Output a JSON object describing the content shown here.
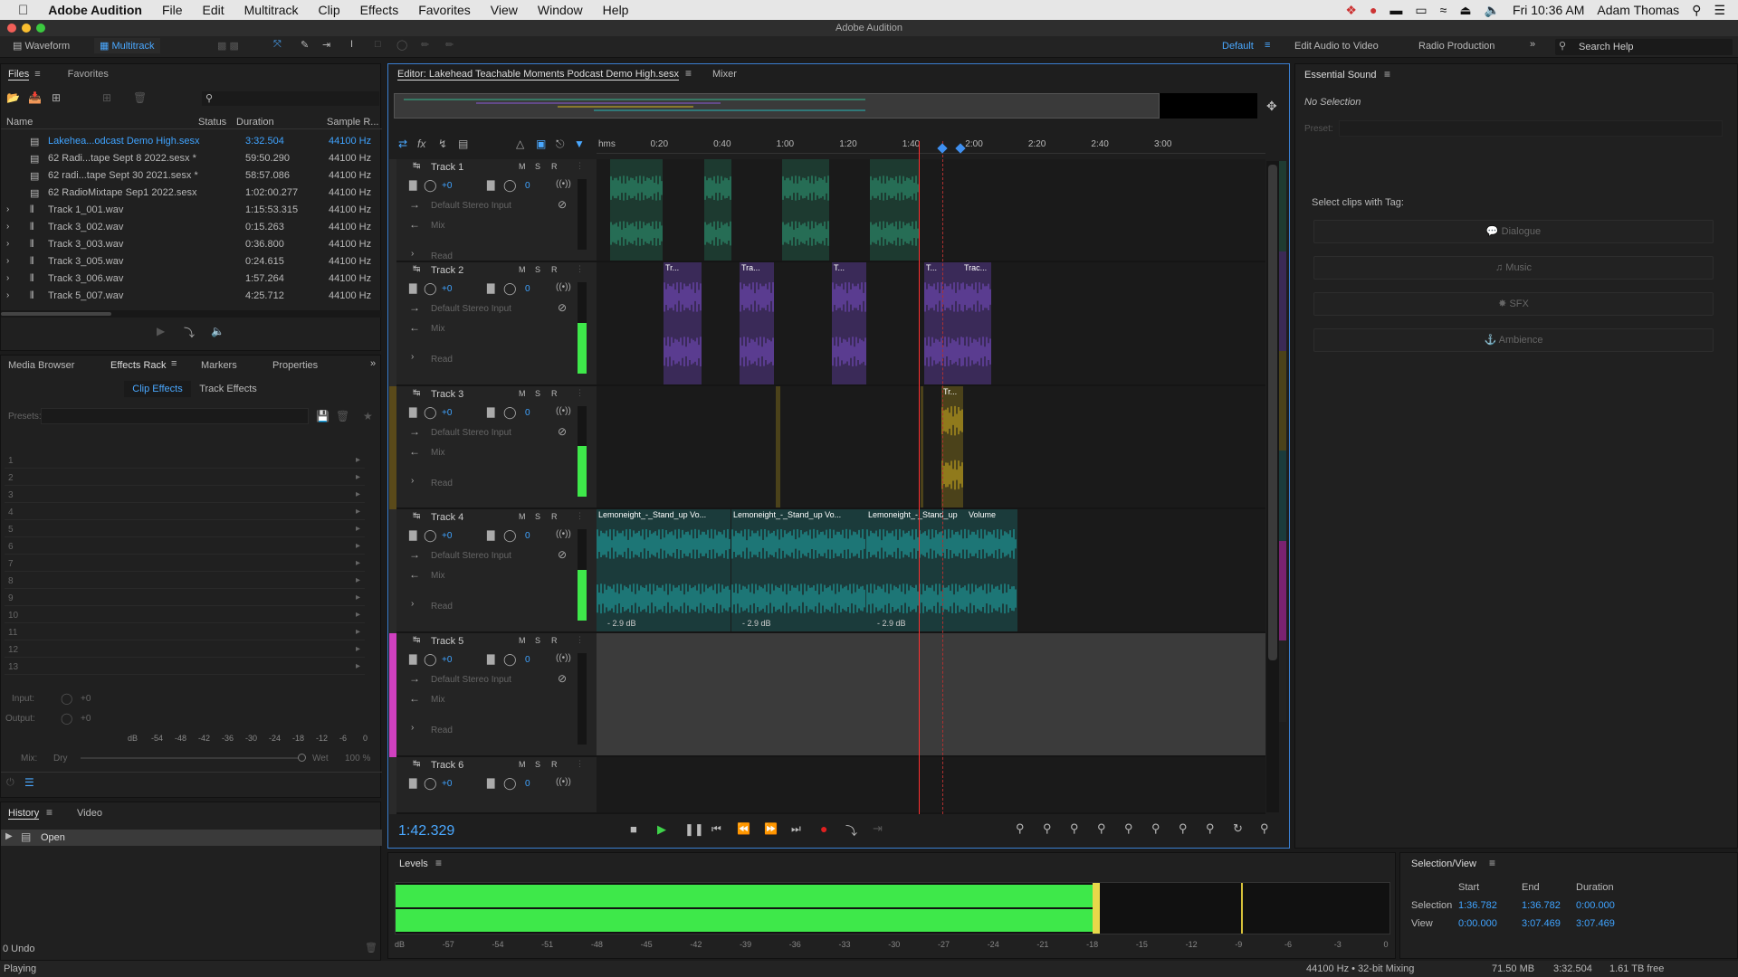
{
  "menubar": {
    "app_name": "Adobe Audition",
    "items": [
      "File",
      "Edit",
      "Multitrack",
      "Clip",
      "Effects",
      "Favorites",
      "View",
      "Window",
      "Help"
    ],
    "clock": "Fri 10:36 AM",
    "user": "Adam Thomas"
  },
  "window_title": "Adobe Audition",
  "toolbar": {
    "waveform_label": "Waveform",
    "multitrack_label": "Multitrack",
    "workspace_default": "Default",
    "workspace_edit_video": "Edit Audio to Video",
    "workspace_radio": "Radio Production",
    "search_placeholder": "Search Help"
  },
  "files_panel": {
    "tab_files": "Files",
    "tab_favorites": "Favorites",
    "columns": [
      "Name",
      "Status",
      "Duration",
      "Sample R..."
    ],
    "rows": [
      {
        "name": "Lakehea...odcast Demo High.sesx",
        "duration": "3:32.504",
        "rate": "44100 Hz",
        "active": true
      },
      {
        "name": "62 Radi...tape Sept 8 2022.sesx *",
        "duration": "59:50.290",
        "rate": "44100 Hz"
      },
      {
        "name": "62 radi...tape Sept 30 2021.sesx *",
        "duration": "58:57.086",
        "rate": "44100 Hz"
      },
      {
        "name": "62 RadioMixtape Sep1 2022.sesx",
        "duration": "1:02:00.277",
        "rate": "44100 Hz"
      },
      {
        "name": "Track 1_001.wav",
        "duration": "1:15:53.315",
        "rate": "44100 Hz"
      },
      {
        "name": "Track 3_002.wav",
        "duration": "0:15.263",
        "rate": "44100 Hz"
      },
      {
        "name": "Track 3_003.wav",
        "duration": "0:36.800",
        "rate": "44100 Hz"
      },
      {
        "name": "Track 3_005.wav",
        "duration": "0:24.615",
        "rate": "44100 Hz"
      },
      {
        "name": "Track 3_006.wav",
        "duration": "1:57.264",
        "rate": "44100 Hz"
      },
      {
        "name": "Track 5_007.wav",
        "duration": "4:25.712",
        "rate": "44100 Hz"
      }
    ]
  },
  "effects_panel": {
    "tabs": [
      "Media Browser",
      "Effects Rack",
      "Markers",
      "Properties"
    ],
    "subtabs": [
      "Clip Effects",
      "Track Effects"
    ],
    "presets_label": "Presets:",
    "slots": [
      "1",
      "2",
      "3",
      "4",
      "5",
      "6",
      "7",
      "8",
      "9",
      "10",
      "11",
      "12",
      "13"
    ],
    "input_label": "Input:",
    "output_label": "Output:",
    "gain_value": "+0",
    "db_scale": [
      "dB",
      "-54",
      "-48",
      "-42",
      "-36",
      "-30",
      "-24",
      "-18",
      "-12",
      "-6",
      "0"
    ],
    "mix_label": "Mix:",
    "dry_label": "Dry",
    "wet_label": "Wet",
    "mix_value": "100 %"
  },
  "history_panel": {
    "tabs": [
      "History",
      "Video"
    ],
    "items": [
      "Open"
    ],
    "undo_count": "0 Undo"
  },
  "status_bar": {
    "state": "Playing",
    "sample_info": "44100 Hz • 32-bit Mixing",
    "memory": "71.50 MB",
    "duration": "3:32.504",
    "disk_free": "1.61 TB free"
  },
  "editor": {
    "title": "Editor: Lakehead Teachable Moments Podcast Demo High.sesx",
    "mixer_tab": "Mixer",
    "time_ruler": [
      "hms",
      "0:20",
      "0:40",
      "1:00",
      "1:20",
      "1:40",
      "2:00",
      "2:20",
      "2:40",
      "3:00"
    ],
    "current_time": "1:42.329",
    "playhead_seconds": 102.329,
    "timeline_total_seconds": 212.504,
    "tracks": [
      {
        "name": "Track 1",
        "color": "#2fa07a",
        "input": "Default Stereo Input",
        "output": "Mix",
        "mode": "Read",
        "volume": "+0",
        "pan": "0"
      },
      {
        "name": "Track 2",
        "color": "#7b4dc9",
        "input": "Default Stereo Input",
        "output": "Mix",
        "mode": "Read",
        "volume": "+0",
        "pan": "0"
      },
      {
        "name": "Track 3",
        "color": "#d4b21e",
        "input": "Default Stereo Input",
        "output": "Mix",
        "mode": "Read",
        "volume": "+0",
        "pan": "0"
      },
      {
        "name": "Track 4",
        "color": "#1fb0b0",
        "input": "Default Stereo Input",
        "output": "Mix",
        "mode": "Read",
        "volume": "+0",
        "pan": "0"
      },
      {
        "name": "Track 5",
        "color": "#e040d0",
        "input": "Default Stereo Input",
        "output": "Mix",
        "mode": "Read",
        "volume": "+0",
        "pan": "0"
      },
      {
        "name": "Track 6",
        "color": "#3a3a3a",
        "volume": "+0",
        "pan": "0"
      }
    ],
    "track2_clips": [
      "Tr...",
      "Tra...",
      "T...",
      "T...",
      "Trac..."
    ],
    "track3_clips": [
      "Tr..."
    ],
    "track4_clips": [
      "Lemoneight_-_Stand_up Vo...",
      "Lemoneight_-_Stand_up Vo...",
      "Lemoneight_-_Stand_up"
    ],
    "track4_volume_label": "Volume",
    "track4_clip_gain": "- 2.9 dB",
    "msr": [
      "M",
      "S",
      "R"
    ]
  },
  "essential_sound": {
    "title": "Essential Sound",
    "no_selection": "No Selection",
    "preset_label": "Preset:",
    "tag_label": "Select clips with Tag:",
    "tags": [
      "Dialogue",
      "Music",
      "SFX",
      "Ambience"
    ]
  },
  "levels": {
    "title": "Levels",
    "scale": [
      "dB",
      "-57",
      "-54",
      "-51",
      "-48",
      "-45",
      "-42",
      "-39",
      "-36",
      "-33",
      "-30",
      "-27",
      "-24",
      "-21",
      "-18",
      "-15",
      "-12",
      "-9",
      "-6",
      "-3",
      "0"
    ],
    "level_db": -18,
    "peak_db": -9
  },
  "selection_view": {
    "title": "Selection/View",
    "col_start": "Start",
    "col_end": "End",
    "col_duration": "Duration",
    "selection_label": "Selection",
    "view_label": "View",
    "selection": {
      "start": "1:36.782",
      "end": "1:36.782",
      "duration": "0:00.000"
    },
    "view": {
      "start": "0:00.000",
      "end": "3:07.469",
      "duration": "3:07.469"
    }
  }
}
